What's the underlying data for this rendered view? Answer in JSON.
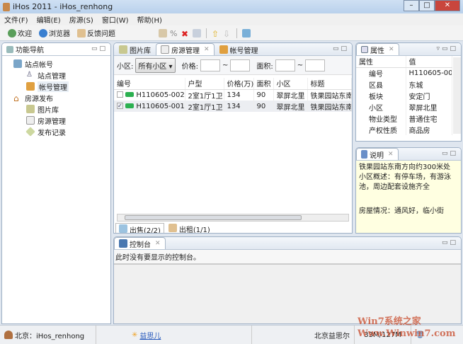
{
  "window": {
    "title": "iHos 2011 - iHos_renhong"
  },
  "menu": [
    "文件(F)",
    "编辑(E)",
    "房源(S)",
    "窗口(W)",
    "帮助(H)"
  ],
  "toolbar": {
    "welcome": "欢迎",
    "browser": "浏览器",
    "feedback": "反馈问题"
  },
  "nav": {
    "title": "功能导航",
    "items": [
      {
        "label": "站点帐号",
        "level": 1
      },
      {
        "label": "站点管理",
        "level": 2
      },
      {
        "label": "帐号管理",
        "level": 2,
        "selected": true
      },
      {
        "label": "房源发布",
        "level": 1
      },
      {
        "label": "图片库",
        "level": 2
      },
      {
        "label": "房源管理",
        "level": 2
      },
      {
        "label": "发布记录",
        "level": 2
      }
    ]
  },
  "editor": {
    "tabs": [
      "图片库",
      "房源管理",
      "帐号管理"
    ],
    "filter": {
      "community_label": "小区:",
      "community_value": "所有小区",
      "price_label": "价格:",
      "area_label": "面积:",
      "tilde": "~"
    },
    "columns": [
      "编号",
      "户型",
      "价格(万)",
      "面积",
      "小区",
      "标题"
    ],
    "rows": [
      {
        "checked": false,
        "id": "H110605-002",
        "type": "2室1厅1卫",
        "price": "134",
        "area": "90",
        "community": "翠屏北里",
        "title": "铁果园站东南"
      },
      {
        "checked": true,
        "id": "H110605-001",
        "type": "2室1厅1卫",
        "price": "134",
        "area": "90",
        "community": "翠屏北里",
        "title": "铁果园站东南"
      }
    ],
    "bottom_tabs": [
      "出售(2/2)",
      "出租(1/1)"
    ]
  },
  "properties": {
    "title": "属性",
    "col_name": "属性",
    "col_value": "值",
    "rows": [
      [
        "编号",
        "H110605-00"
      ],
      [
        "区县",
        "东城"
      ],
      [
        "板块",
        "安定门"
      ],
      [
        "小区",
        "翠屏北里"
      ],
      [
        "物业类型",
        "普通住宅"
      ],
      [
        "产权性质",
        "商品房"
      ]
    ]
  },
  "description": {
    "title": "说明",
    "line1": "铁果园站东南方向约300米处",
    "line2": "小区概述：有停车场，有游泳池，周边配套设施齐全",
    "line3": "房屋情况：通风好，临小街"
  },
  "console": {
    "title": "控制台",
    "message": "此时没有要显示的控制台。"
  },
  "status": {
    "user": "北京：iHos_renhong",
    "link": "益思儿",
    "company": "北京益思尔",
    "memory": "33M/127M"
  },
  "watermark": "Win7系统之家 Www.Winwin7.com"
}
